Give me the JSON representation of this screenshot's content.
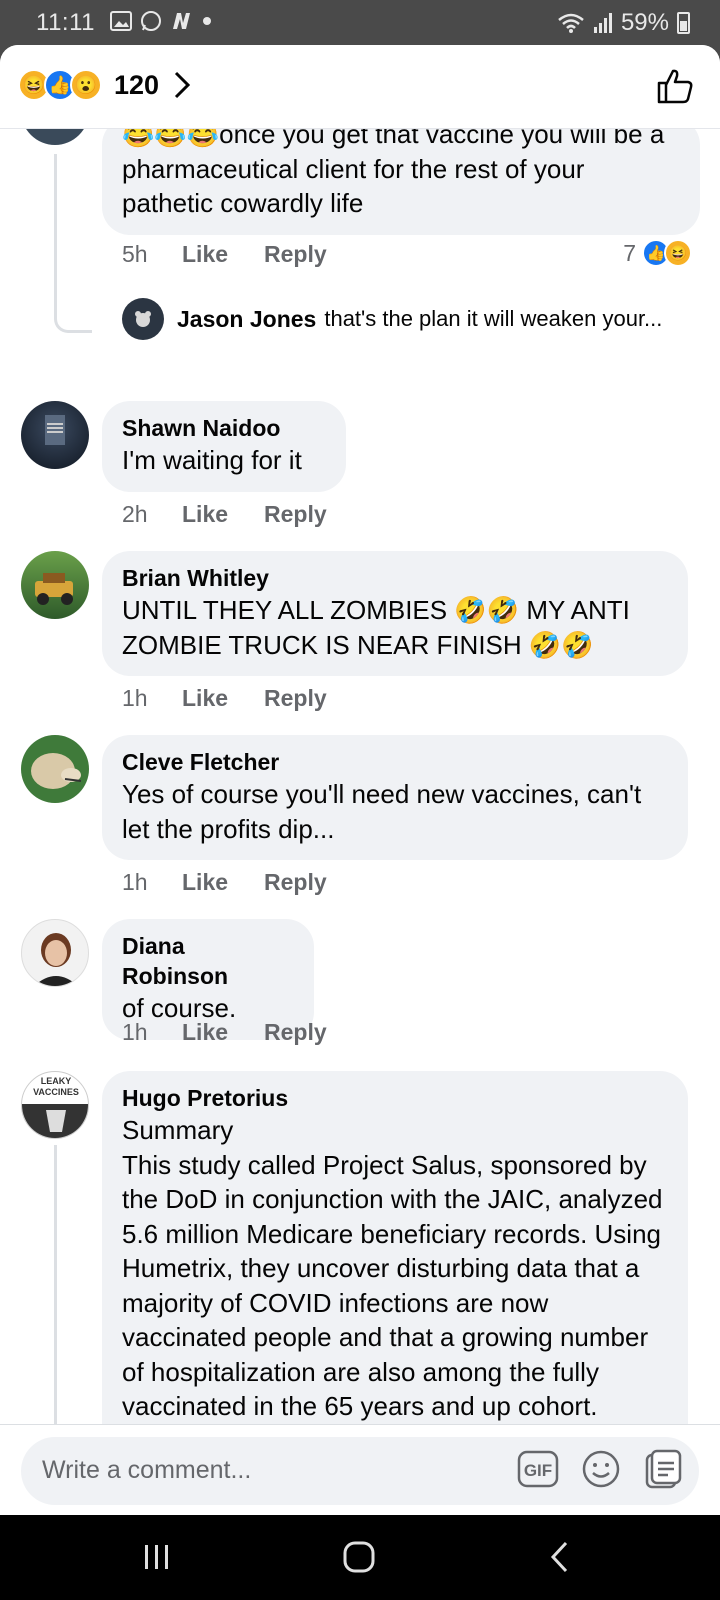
{
  "status": {
    "time": "11:11",
    "battery": "59%"
  },
  "header": {
    "reaction_count": "120"
  },
  "reply_preview": {
    "author": "Jason Jones",
    "text": "that's the plan it will weaken your..."
  },
  "comments": [
    {
      "text": "once you get that vaccine you will be a pharmaceutical client for the rest of your pathetic cowardly life",
      "time": "5h",
      "like": "Like",
      "reply": "Reply",
      "reaction_count": "7"
    },
    {
      "name": "Shawn Naidoo",
      "text": "I'm waiting for it",
      "time": "2h",
      "like": "Like",
      "reply": "Reply"
    },
    {
      "name": "Brian Whitley",
      "text_a": "UNTIL THEY ALL ZOMBIES",
      "text_b": "MY ANTI",
      "text_c": "ZOMBIE TRUCK IS NEAR FINISH",
      "time": "1h",
      "like": "Like",
      "reply": "Reply"
    },
    {
      "name": "Cleve Fletcher",
      "text": "Yes of course you'll need new vaccines, can't let the profits dip...",
      "time": "1h",
      "like": "Like",
      "reply": "Reply"
    },
    {
      "name": "Diana Robinson",
      "text": "of course.",
      "time": "1h",
      "like": "Like",
      "reply": "Reply"
    },
    {
      "name": "Hugo Pretorius",
      "avatar_text": "LEAKY VACCINES",
      "text_title": "Summary",
      "text": "This study called Project Salus, sponsored by the DoD in conjunction with the JAIC, analyzed 5.6 million Medicare beneficiary records. Using Humetrix, they uncover disturbing data that a majority of COVID infections are now vaccinated people and that a growing number of hospitalization are also among the fully vaccinated in the 65 years and up cohort."
    }
  ],
  "composer": {
    "placeholder": "Write a comment...",
    "gif_label": "GIF"
  }
}
